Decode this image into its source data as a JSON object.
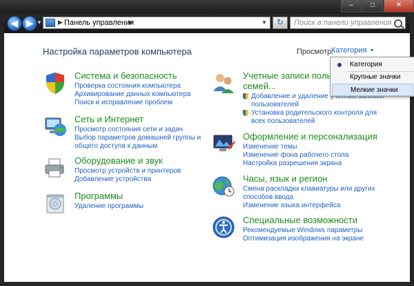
{
  "window": {
    "minimize": "–",
    "maximize": "□",
    "close": "✕"
  },
  "nav": {
    "back": "◀",
    "forward": "▶",
    "address_separator": "▶",
    "address": "Панель управления",
    "address_separator_after": "▶",
    "refresh": "↻",
    "search_placeholder": "Поиск в панели управления"
  },
  "header": {
    "title": "Настройка параметров компьютера",
    "view_by_label": "Просмотр:",
    "view_by_value": "Категория",
    "view_by_chevron": "▼"
  },
  "dropdown": {
    "items": [
      "Категория",
      "Крупные значки",
      "Мелкие значки"
    ],
    "selected": "Категория",
    "highlighted": "Мелкие значки"
  },
  "categories": {
    "system": {
      "title": "Система и безопасность",
      "links": [
        "Проверка состояния компьютера",
        "Архивирование данных компьютера",
        "Поиск и исправление проблем"
      ]
    },
    "network": {
      "title": "Сеть и Интернет",
      "links": [
        "Просмотр состояния сети и задач",
        "Выбор параметров домашней группы и",
        "общего доступа к данным"
      ]
    },
    "hardware": {
      "title": "Оборудование и звук",
      "links": [
        "Просмотр устройств и принтеров",
        "Добавление устройства"
      ]
    },
    "programs": {
      "title": "Программы",
      "links": [
        "Удаление программы"
      ]
    },
    "accounts": {
      "title_line1": "Учетные записи польз",
      "title_line2": "семей...",
      "links": [
        "Добавление и удаление учетных записей",
        "пользователей",
        "Установка родительского контроля для",
        "всех пользователей"
      ]
    },
    "appearance": {
      "title": "Оформление и персонализация",
      "links": [
        "Изменение темы",
        "Изменение фона рабочего стола",
        "Настройка разрешения экрана"
      ]
    },
    "clock": {
      "title": "Часы, язык и регион",
      "links": [
        "Смена раскладки клавиатуры или других",
        "способов ввода",
        "Изменение языка интерфейса"
      ]
    },
    "access": {
      "title": "Специальные возможности",
      "links": [
        "Рекомендуемые Windows параметры",
        "Оптимизация изображения на экране"
      ]
    }
  }
}
